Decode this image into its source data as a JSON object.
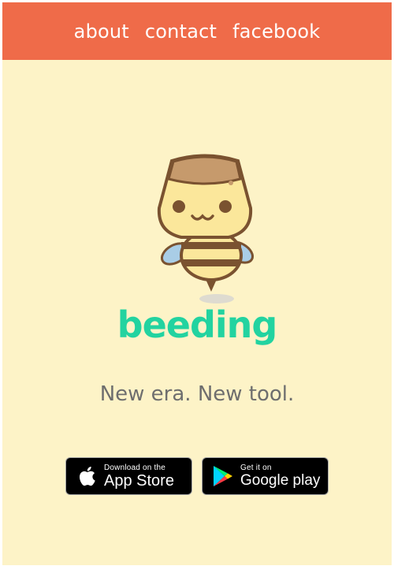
{
  "nav": {
    "links": [
      {
        "label": "about"
      },
      {
        "label": "contact"
      },
      {
        "label": "facebook"
      }
    ]
  },
  "brand": {
    "logo": "beeding",
    "tagline": "New era. New tool."
  },
  "badges": {
    "app_store": {
      "small": "Download on the",
      "big": "App Store"
    },
    "google_play": {
      "small": "Get it on",
      "big_google": "Google",
      "big_play": " play"
    }
  },
  "colors": {
    "header": "#ef6b49",
    "background": "#fdf3c7",
    "logo": "#22d3a0"
  },
  "icons": {
    "mascot": "bee-mascot",
    "app_store": "apple-icon",
    "google_play": "google-play-icon"
  }
}
